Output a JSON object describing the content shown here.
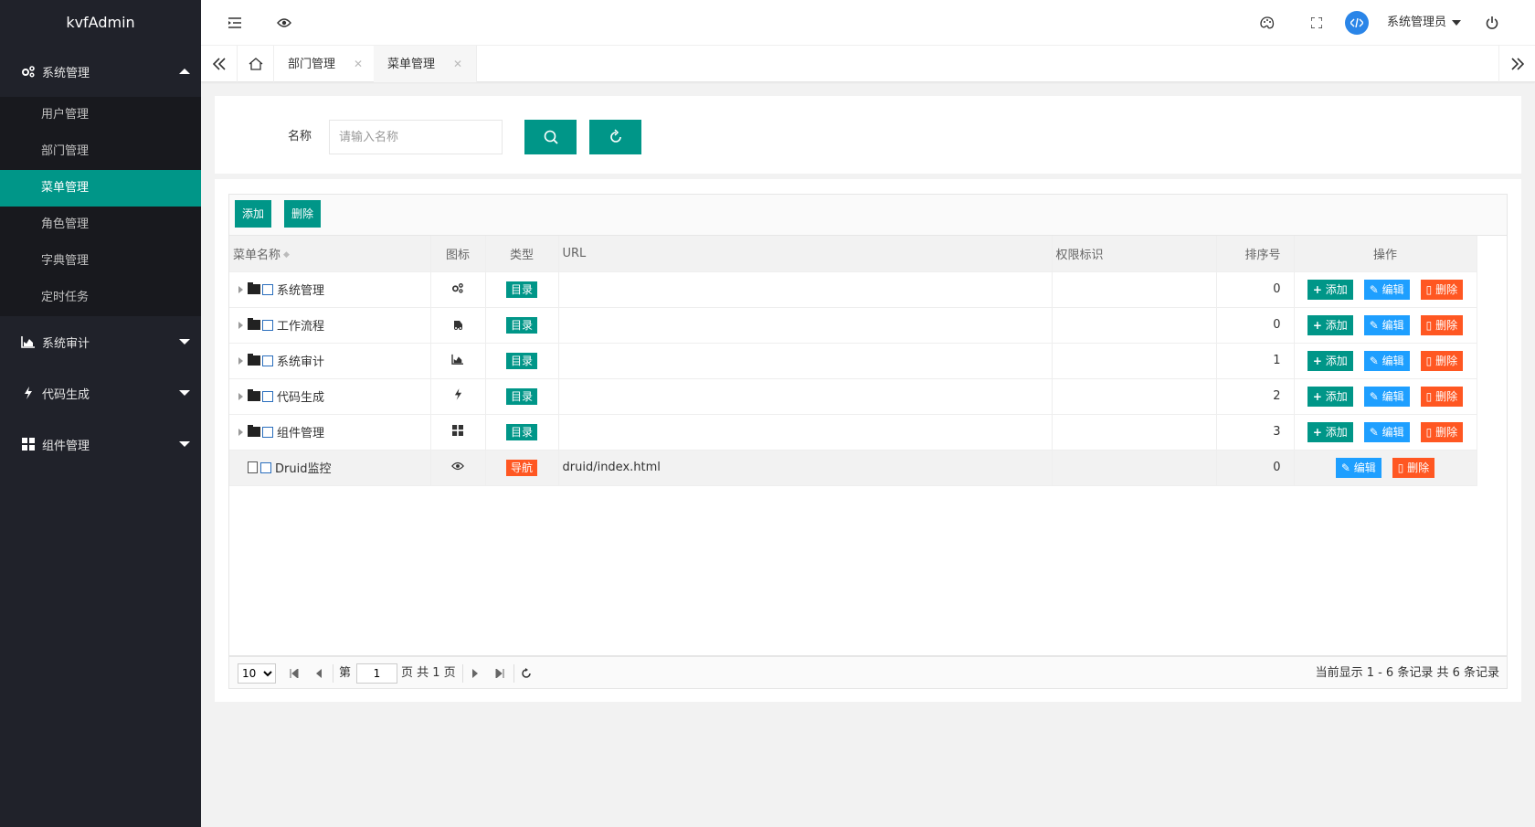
{
  "app": {
    "title": "kvfAdmin"
  },
  "sidebar": {
    "groups": [
      {
        "label": "系统管理",
        "icon": "cogs-icon",
        "expanded": true,
        "children": [
          {
            "label": "用户管理",
            "active": false
          },
          {
            "label": "部门管理",
            "active": false
          },
          {
            "label": "菜单管理",
            "active": true
          },
          {
            "label": "角色管理",
            "active": false
          },
          {
            "label": "字典管理",
            "active": false
          },
          {
            "label": "定时任务",
            "active": false
          }
        ]
      },
      {
        "label": "系统审计",
        "icon": "area-chart-icon",
        "expanded": false
      },
      {
        "label": "代码生成",
        "icon": "bolt-icon",
        "expanded": false
      },
      {
        "label": "组件管理",
        "icon": "grid-icon",
        "expanded": false
      }
    ]
  },
  "header": {
    "user_name": "系统管理员"
  },
  "tabs": [
    {
      "label": "部门管理",
      "active": false
    },
    {
      "label": "菜单管理",
      "active": true
    }
  ],
  "search": {
    "label": "名称",
    "placeholder": "请输入名称",
    "value": ""
  },
  "toolbar": {
    "add_label": "添加",
    "delete_label": "删除"
  },
  "table": {
    "columns": [
      "菜单名称",
      "图标",
      "类型",
      "URL",
      "权限标识",
      "排序号",
      "操作"
    ],
    "rows": [
      {
        "name": "系统管理",
        "icon": "cogs-icon",
        "type": "目录",
        "url": "",
        "perm": "",
        "order": "0",
        "expandable": true,
        "actions": [
          "添加",
          "编辑",
          "删除"
        ]
      },
      {
        "name": "工作流程",
        "icon": "ambulance-icon",
        "type": "目录",
        "url": "",
        "perm": "",
        "order": "0",
        "expandable": true,
        "actions": [
          "添加",
          "编辑",
          "删除"
        ]
      },
      {
        "name": "系统审计",
        "icon": "area-chart-icon",
        "type": "目录",
        "url": "",
        "perm": "",
        "order": "1",
        "expandable": true,
        "actions": [
          "添加",
          "编辑",
          "删除"
        ]
      },
      {
        "name": "代码生成",
        "icon": "bolt-icon",
        "type": "目录",
        "url": "",
        "perm": "",
        "order": "2",
        "expandable": true,
        "actions": [
          "添加",
          "编辑",
          "删除"
        ]
      },
      {
        "name": "组件管理",
        "icon": "grid-icon",
        "type": "目录",
        "url": "",
        "perm": "",
        "order": "3",
        "expandable": true,
        "actions": [
          "添加",
          "编辑",
          "删除"
        ]
      },
      {
        "name": "Druid监控",
        "icon": "eye-icon",
        "type": "导航",
        "url": "druid/index.html",
        "perm": "",
        "order": "0",
        "expandable": false,
        "actions": [
          "编辑",
          "删除"
        ]
      }
    ]
  },
  "pager": {
    "page_size": "10",
    "page_prefix": "第",
    "current_page": "1",
    "page_suffix": "页 共 1 页",
    "summary": "当前显示 1 - 6 条记录 共 6 条记录"
  },
  "colors": {
    "primary": "#009688",
    "edit": "#1e9fff",
    "danger": "#ff5722",
    "sidebar_bg": "#20222a"
  }
}
